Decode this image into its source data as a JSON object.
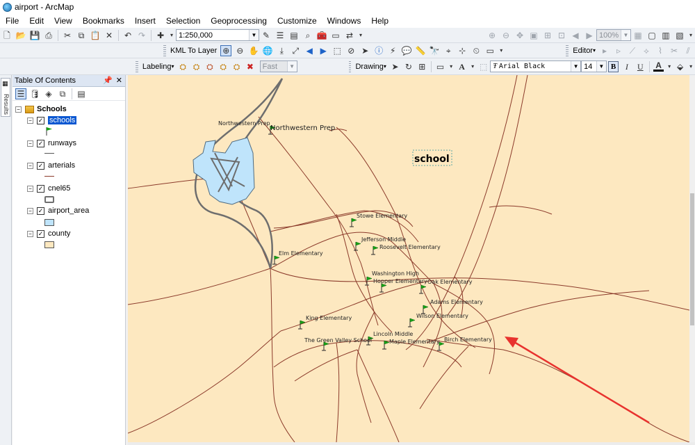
{
  "window": {
    "title": "airport - ArcMap"
  },
  "menu": [
    "File",
    "Edit",
    "View",
    "Bookmarks",
    "Insert",
    "Selection",
    "Geoprocessing",
    "Customize",
    "Windows",
    "Help"
  ],
  "toolbar": {
    "scale": "1:250,000",
    "zoom": "100%",
    "kml_to_layer": "KML To Layer",
    "editor": "Editor",
    "labeling": "Labeling",
    "label_quality": "Fast",
    "drawing": "Drawing",
    "font_name": "Arial Black",
    "font_size": "14",
    "bold": "B",
    "italic": "I",
    "underline": "U"
  },
  "side_tab": "Results",
  "toc": {
    "title": "Table Of Contents",
    "root": "Schools",
    "layers": [
      {
        "name": "schools",
        "selected": true
      },
      {
        "name": "runways",
        "selected": false
      },
      {
        "name": "arterials",
        "selected": false
      },
      {
        "name": "cnel65",
        "selected": false
      },
      {
        "name": "airport_area",
        "selected": false
      },
      {
        "name": "county",
        "selected": false
      }
    ]
  },
  "colors": {
    "county_fill": "#fde8c0",
    "road": "#8b3a2a",
    "airport_fill": "#bfe4fb",
    "cnel_outline": "#6e6e6e",
    "school_flag": "#17a317",
    "selection": "#0a57d1",
    "annotation_arrow": "#e8322e"
  },
  "map": {
    "text_element": "school",
    "schools": [
      "Northwestern Prep",
      "Northwestern Prep",
      "Stowe Elementary",
      "Jefferson Middle",
      "Roosevelt Elementary",
      "Elm Elementary",
      "Washington High",
      "Hopper Elementary",
      "Oak Elementary",
      "Adams Elementary",
      "Wilson Elementary",
      "King Elementary",
      "Lincoln Middle",
      "The Green Valley School",
      "Maple Elementary",
      "Birch Elementary"
    ]
  }
}
